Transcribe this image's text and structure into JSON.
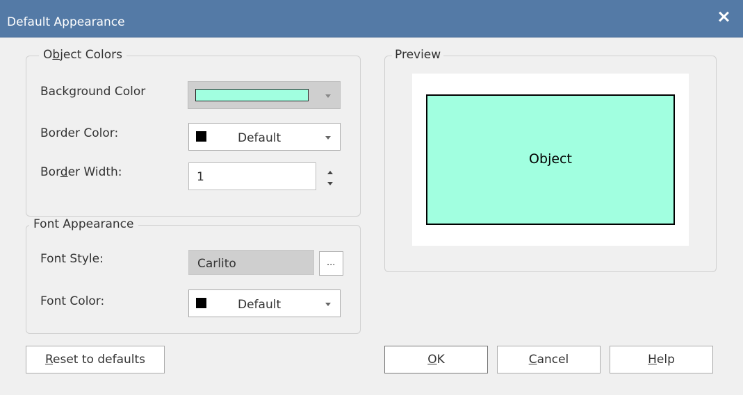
{
  "window": {
    "title": "Default Appearance"
  },
  "object_colors": {
    "legend": {
      "pre": "O",
      "key": "b",
      "post": "ject Colors"
    },
    "background_color": {
      "label": "Background Color",
      "swatch_color": "#a1ffe0"
    },
    "border_color": {
      "label": "Border Color:",
      "value": "Default",
      "swatch_color": "#000000"
    },
    "border_width": {
      "label": {
        "pre": "Bor",
        "key": "d",
        "post": "er Width:"
      },
      "value": "1"
    }
  },
  "font_appearance": {
    "legend": "Font Appearance",
    "font_style": {
      "label": "Font Style:",
      "value": "Carlito",
      "browse_label": "..."
    },
    "font_color": {
      "label": "Font Color:",
      "value": "Default",
      "swatch_color": "#000000"
    }
  },
  "preview": {
    "legend": "Preview",
    "object_label": "Object",
    "object_fill": "#a1ffe0"
  },
  "buttons": {
    "reset": {
      "key": "R",
      "rest": "eset to defaults"
    },
    "ok": {
      "key": "O",
      "rest": "K"
    },
    "cancel": {
      "key": "C",
      "rest": "ancel"
    },
    "help": {
      "key": "H",
      "rest": "elp"
    }
  },
  "colors": {
    "titlebar": "#547aa6",
    "dialog_bg": "#f0f0f0"
  },
  "icons": [
    "close-icon",
    "dropdown-arrow-icon",
    "spin-up-icon",
    "spin-down-icon"
  ]
}
